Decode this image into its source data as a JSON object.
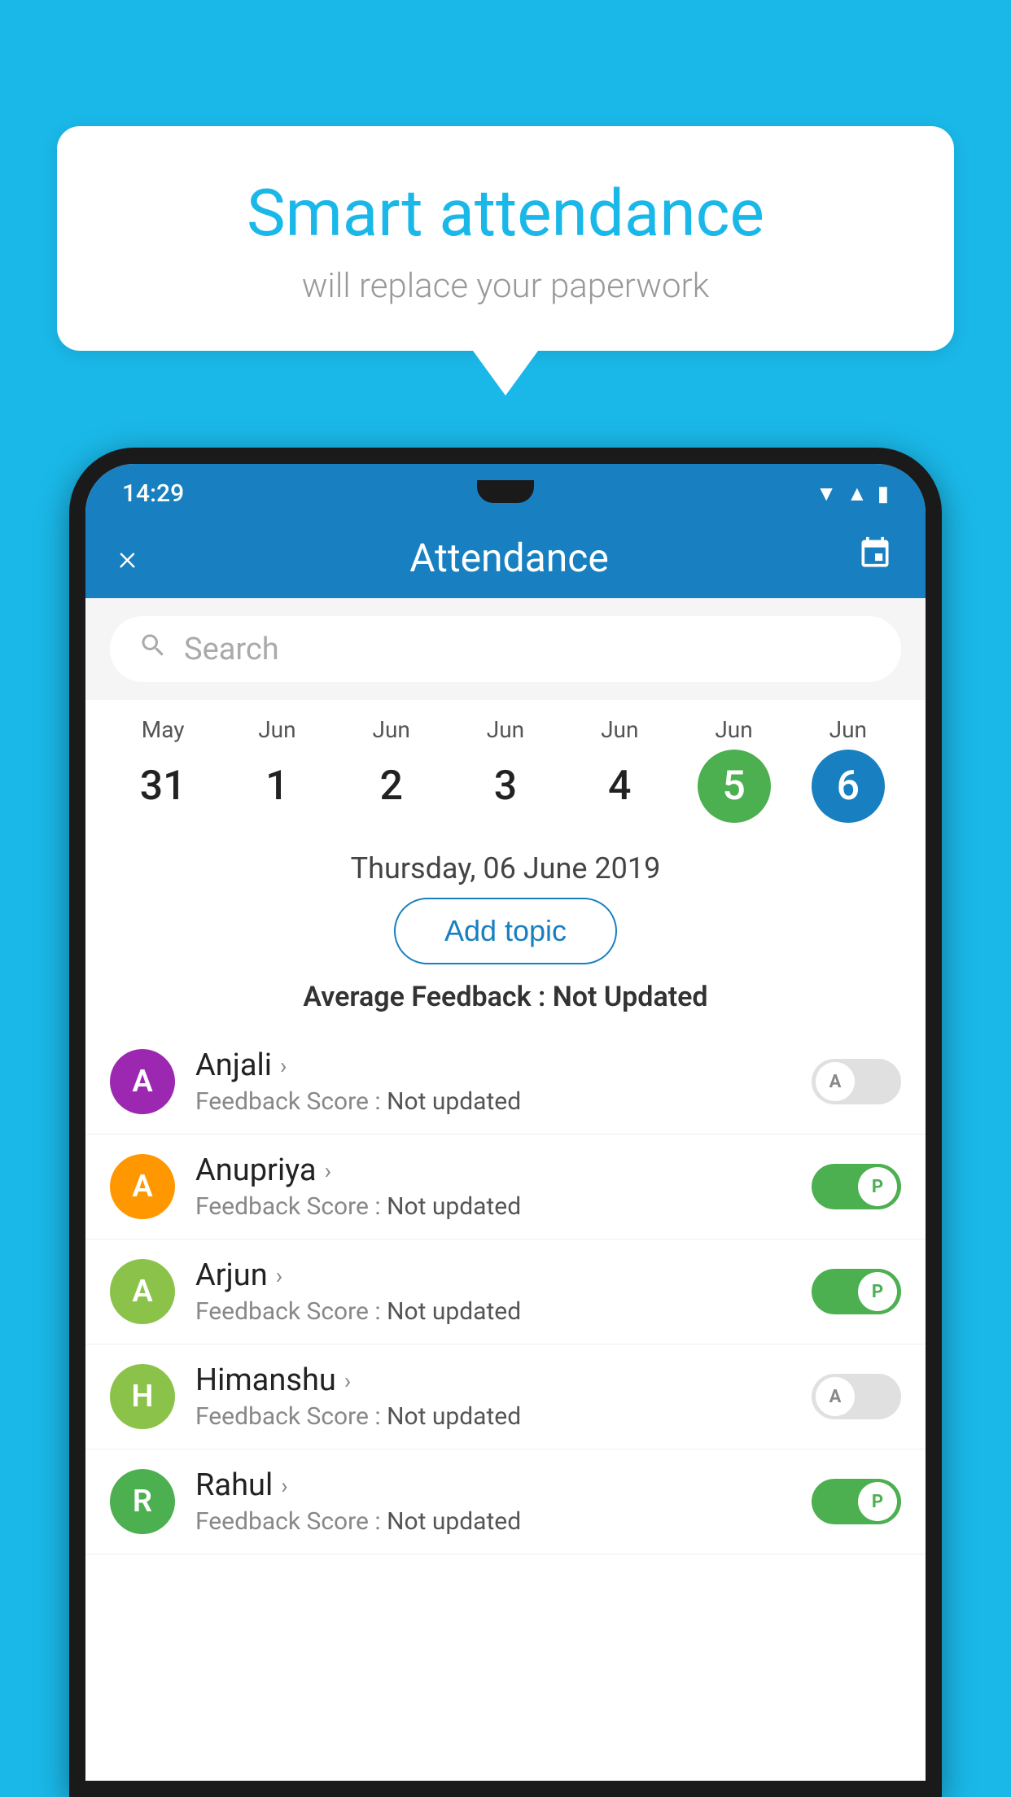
{
  "background_color": "#1ab8e8",
  "speech_bubble": {
    "title": "Smart attendance",
    "subtitle": "will replace your paperwork"
  },
  "status_bar": {
    "time": "14:29",
    "icons": [
      "wifi",
      "signal",
      "battery"
    ]
  },
  "app_bar": {
    "close_label": "×",
    "title": "Attendance",
    "calendar_icon": "📅"
  },
  "search": {
    "placeholder": "Search"
  },
  "calendar": {
    "days": [
      {
        "month": "May",
        "date": "31",
        "style": "normal"
      },
      {
        "month": "Jun",
        "date": "1",
        "style": "normal"
      },
      {
        "month": "Jun",
        "date": "2",
        "style": "normal"
      },
      {
        "month": "Jun",
        "date": "3",
        "style": "normal"
      },
      {
        "month": "Jun",
        "date": "4",
        "style": "normal"
      },
      {
        "month": "Jun",
        "date": "5",
        "style": "today"
      },
      {
        "month": "Jun",
        "date": "6",
        "style": "selected"
      }
    ]
  },
  "selected_date": "Thursday, 06 June 2019",
  "add_topic_label": "Add topic",
  "avg_feedback_label": "Average Feedback :",
  "avg_feedback_value": "Not Updated",
  "students": [
    {
      "name": "Anjali",
      "avatar_letter": "A",
      "avatar_color": "#9c27b0",
      "feedback_label": "Feedback Score :",
      "feedback_value": "Not updated",
      "attendance": "absent",
      "toggle_letter": "A"
    },
    {
      "name": "Anupriya",
      "avatar_letter": "A",
      "avatar_color": "#ff9800",
      "feedback_label": "Feedback Score :",
      "feedback_value": "Not updated",
      "attendance": "present",
      "toggle_letter": "P"
    },
    {
      "name": "Arjun",
      "avatar_letter": "A",
      "avatar_color": "#8bc34a",
      "feedback_label": "Feedback Score :",
      "feedback_value": "Not updated",
      "attendance": "present",
      "toggle_letter": "P"
    },
    {
      "name": "Himanshu",
      "avatar_letter": "H",
      "avatar_color": "#8bc34a",
      "feedback_label": "Feedback Score :",
      "feedback_value": "Not updated",
      "attendance": "absent",
      "toggle_letter": "A"
    },
    {
      "name": "Rahul",
      "avatar_letter": "R",
      "avatar_color": "#4caf50",
      "feedback_label": "Feedback Score :",
      "feedback_value": "Not updated",
      "attendance": "present",
      "toggle_letter": "P"
    }
  ]
}
